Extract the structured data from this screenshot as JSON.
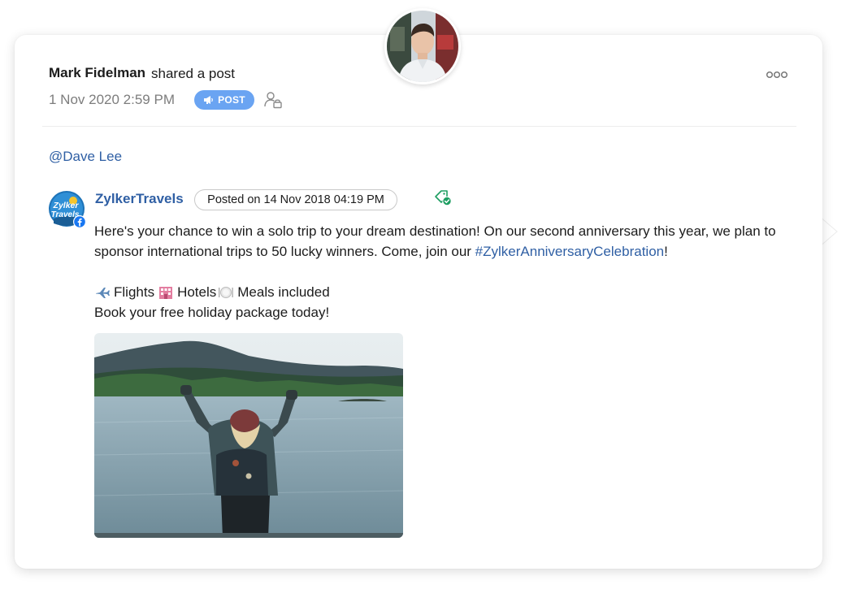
{
  "activity": {
    "author_name": "Mark Fidelman",
    "action_text": "shared a post",
    "timestamp": "1 Nov 2020 2:59 PM",
    "badge_label": "POST",
    "mention": "@Dave Lee"
  },
  "shared_post": {
    "page_name": "ZylkerTravels",
    "page_logo_text_1": "Zylker",
    "page_logo_text_2": "Travels",
    "posted_on": "Posted on 14 Nov 2018 04:19 PM",
    "text_part_1": "Here's your chance to win a solo trip to your dream destination! On our second anniversary this year, we plan to",
    "text_part_2": "sponsor international trips to 50 lucky winners. Come, join our ",
    "hashtag": "#ZylkerAnniversaryCelebration",
    "text_part_3": "!",
    "flights_label": "Flights",
    "hotels_label": "Hotels",
    "meals_label": "Meals included",
    "closing_line": "Book your free holiday package today!"
  },
  "icons": {
    "badge_icon": "megaphone-icon",
    "audience_icon": "user-lock-icon",
    "more_icon": "more-horizontal-icon",
    "verified_icon": "tag-check-icon",
    "network_icon": "facebook-icon",
    "flights_icon": "airplane-icon",
    "hotels_icon": "hotel-icon",
    "meals_icon": "plate-icon"
  },
  "colors": {
    "link_blue": "#2f5fa4",
    "badge_blue": "#6aa4f2",
    "verified_green": "#1e9e62",
    "facebook_blue": "#1877f2"
  }
}
